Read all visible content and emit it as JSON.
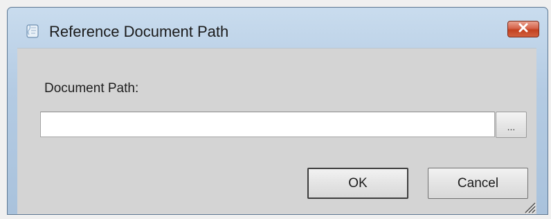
{
  "window": {
    "title": "Reference Document Path",
    "icon": "document-icon",
    "close_icon": "close-x-icon"
  },
  "form": {
    "path_label": "Document Path:",
    "path_value": "",
    "path_placeholder": "",
    "browse_label": "..."
  },
  "buttons": {
    "ok_label": "OK",
    "cancel_label": "Cancel"
  },
  "colors": {
    "close_button": "#c2411f",
    "dialog_background": "#d4d4d4",
    "frame": "#b4cbe3"
  }
}
